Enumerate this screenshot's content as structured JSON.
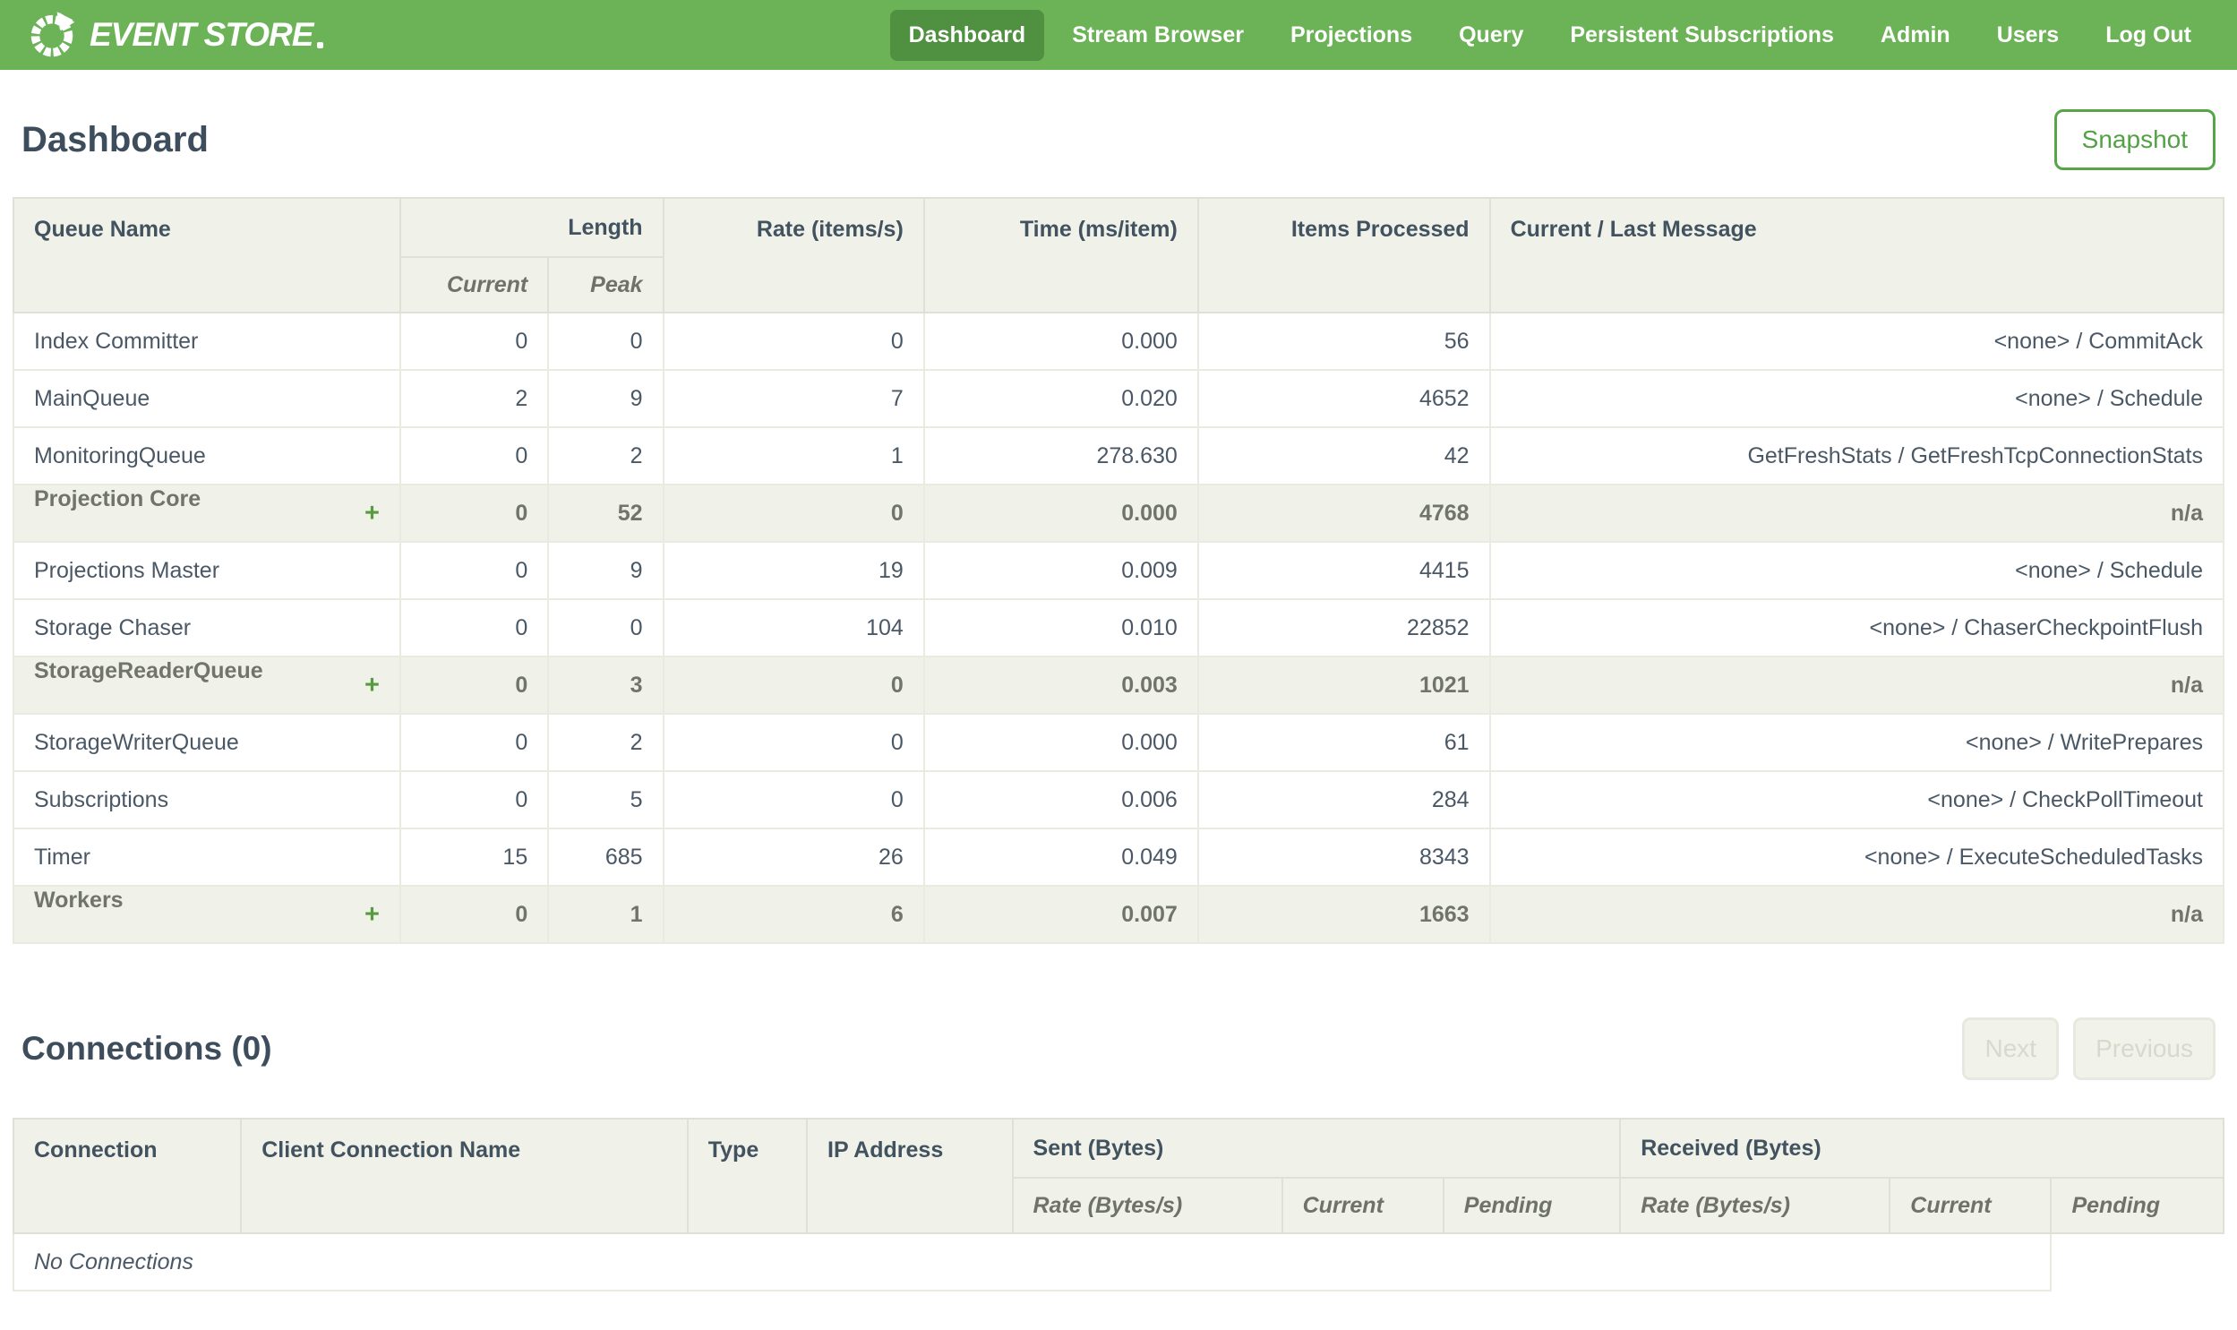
{
  "colors": {
    "nav_background": "#6cb257",
    "nav_active": "#4f9140",
    "accent_green": "#53a145",
    "plus_green": "#579b40",
    "header_background": "#f0f2ea",
    "border": "#dfe1d5",
    "text_dark": "#3d4d5c",
    "text_gray": "#70746a"
  },
  "nav": {
    "brand": "EVENT STORE",
    "items": [
      {
        "label": "Dashboard",
        "active": true
      },
      {
        "label": "Stream Browser",
        "active": false
      },
      {
        "label": "Projections",
        "active": false
      },
      {
        "label": "Query",
        "active": false
      },
      {
        "label": "Persistent Subscriptions",
        "active": false
      },
      {
        "label": "Admin",
        "active": false
      },
      {
        "label": "Users",
        "active": false
      },
      {
        "label": "Log Out",
        "active": false
      }
    ]
  },
  "page": {
    "title": "Dashboard",
    "snapshot_button": "Snapshot"
  },
  "queue_table": {
    "expand_icon": "+",
    "headers": {
      "queue_name": "Queue Name",
      "length": "Length",
      "current": "Current",
      "peak": "Peak",
      "rate": "Rate (items/s)",
      "time": "Time (ms/item)",
      "items_processed": "Items Processed",
      "message": "Current / Last Message"
    },
    "rows": [
      {
        "name": "Index Committer",
        "group": false,
        "current": "0",
        "peak": "0",
        "rate": "0",
        "time": "0.000",
        "items": "56",
        "message": "<none> / CommitAck"
      },
      {
        "name": "MainQueue",
        "group": false,
        "current": "2",
        "peak": "9",
        "rate": "7",
        "time": "0.020",
        "items": "4652",
        "message": "<none> / Schedule"
      },
      {
        "name": "MonitoringQueue",
        "group": false,
        "current": "0",
        "peak": "2",
        "rate": "1",
        "time": "278.630",
        "items": "42",
        "message": "GetFreshStats / GetFreshTcpConnectionStats"
      },
      {
        "name": "Projection Core",
        "group": true,
        "current": "0",
        "peak": "52",
        "rate": "0",
        "time": "0.000",
        "items": "4768",
        "message": "n/a"
      },
      {
        "name": "Projections Master",
        "group": false,
        "current": "0",
        "peak": "9",
        "rate": "19",
        "time": "0.009",
        "items": "4415",
        "message": "<none> / Schedule"
      },
      {
        "name": "Storage Chaser",
        "group": false,
        "current": "0",
        "peak": "0",
        "rate": "104",
        "time": "0.010",
        "items": "22852",
        "message": "<none> / ChaserCheckpointFlush"
      },
      {
        "name": "StorageReaderQueue",
        "group": true,
        "current": "0",
        "peak": "3",
        "rate": "0",
        "time": "0.003",
        "items": "1021",
        "message": "n/a"
      },
      {
        "name": "StorageWriterQueue",
        "group": false,
        "current": "0",
        "peak": "2",
        "rate": "0",
        "time": "0.000",
        "items": "61",
        "message": "<none> / WritePrepares"
      },
      {
        "name": "Subscriptions",
        "group": false,
        "current": "0",
        "peak": "5",
        "rate": "0",
        "time": "0.006",
        "items": "284",
        "message": "<none> / CheckPollTimeout"
      },
      {
        "name": "Timer",
        "group": false,
        "current": "15",
        "peak": "685",
        "rate": "26",
        "time": "0.049",
        "items": "8343",
        "message": "<none> / ExecuteScheduledTasks"
      },
      {
        "name": "Workers",
        "group": true,
        "current": "0",
        "peak": "1",
        "rate": "6",
        "time": "0.007",
        "items": "1663",
        "message": "n/a"
      }
    ]
  },
  "connections": {
    "title": "Connections (0)",
    "next_button": "Next",
    "previous_button": "Previous",
    "headers": {
      "connection": "Connection",
      "client_name": "Client Connection Name",
      "type": "Type",
      "ip": "IP Address",
      "sent": "Sent (Bytes)",
      "received": "Received (Bytes)",
      "rate": "Rate (Bytes/s)",
      "current": "Current",
      "pending": "Pending"
    },
    "empty_message": "No Connections"
  }
}
